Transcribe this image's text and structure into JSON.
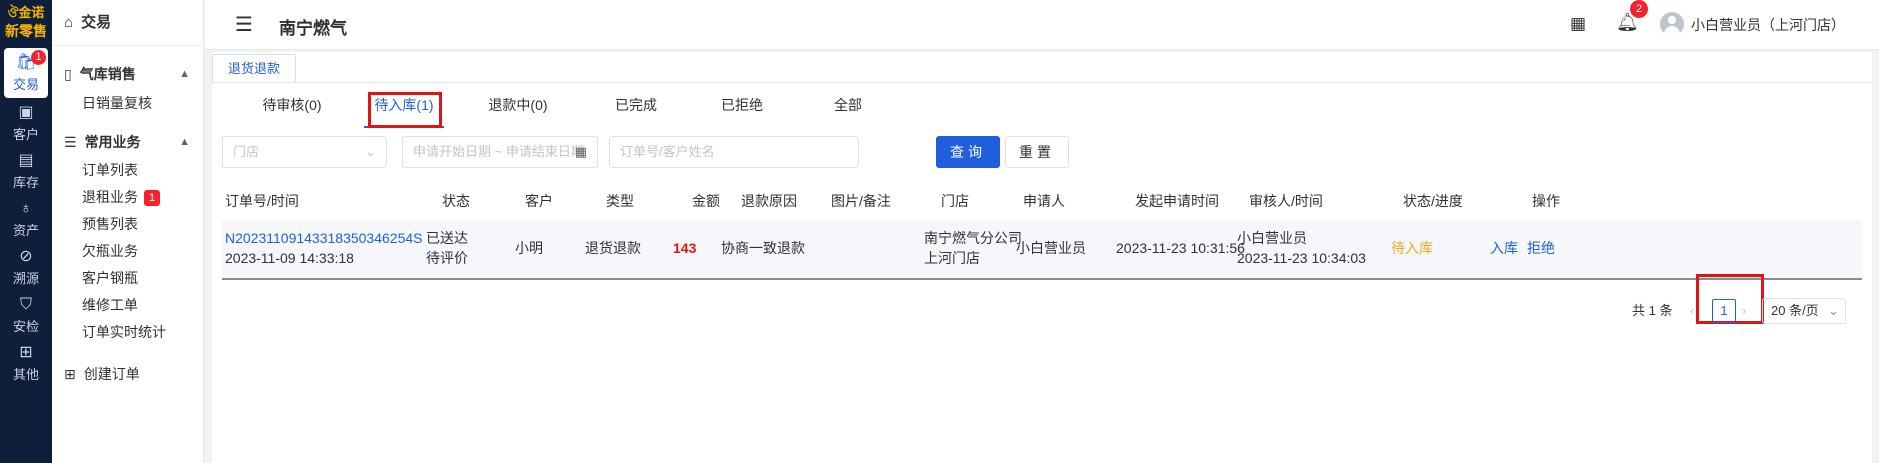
{
  "brand": {
    "line1": "ঔ金诺",
    "line2": "新零售"
  },
  "rail": [
    {
      "icon": "🛍",
      "label": "交易",
      "badge": "1",
      "active": true
    },
    {
      "icon": "▣",
      "label": "客户"
    },
    {
      "icon": "▤",
      "label": "库存"
    },
    {
      "icon": "♁",
      "label": "资产"
    },
    {
      "icon": "⊘",
      "label": "溯源"
    },
    {
      "icon": "⛉",
      "label": "安检"
    },
    {
      "icon": "⊞",
      "label": "其他"
    }
  ],
  "menu": {
    "top": "交易",
    "group1": "气库销售",
    "group1_items": [
      "日销量复核"
    ],
    "group2": "常用业务",
    "group2_items": [
      "订单列表",
      "退租业务",
      "预售列表",
      "欠瓶业务",
      "客户钢瓶",
      "维修工单",
      "订单实时统计"
    ],
    "group2_badge": "1",
    "create": "创建订单"
  },
  "header": {
    "title": "南宁燃气",
    "bell_badge": "2",
    "user": "小白营业员（上河门店）"
  },
  "crumb_tab": "退货退款",
  "tabs": [
    "待审核(0)",
    "待入库(1)",
    "退款中(0)",
    "已完成",
    "已拒绝",
    "全部"
  ],
  "filters": {
    "store_placeholder": "门店",
    "date_start": "申请开始日期",
    "date_sep": "~",
    "date_end": "申请结束日期",
    "order_placeholder": "订单号/客户姓名",
    "query": "查询",
    "reset": "重置"
  },
  "table": {
    "headers": [
      "订单号/时间",
      "状态",
      "客户",
      "类型",
      "金额",
      "退款原因",
      "图片/备注",
      "门店",
      "申请人",
      "发起申请时间",
      "审核人/时间",
      "状态/进度",
      "操作"
    ],
    "rows": [
      {
        "order_no": "N20231109143318350346254S",
        "order_time": "2023-11-09 14:33:18",
        "status1": "已送达",
        "status2": "待评价",
        "customer": "小明",
        "type": "退货退款",
        "amount": "143",
        "reason": "协商一致退款",
        "store1": "南宁燃气分公司",
        "store2": "上河门店",
        "applicant": "小白营业员",
        "apply_time": "2023-11-23 10:31:56",
        "reviewer": "小白营业员",
        "review_time": "2023-11-23 10:34:03",
        "progress": "待入库",
        "action_in": "入库",
        "action_reject": "拒绝"
      }
    ]
  },
  "pager": {
    "total": "共 1 条",
    "page": "1",
    "size": "20 条/页"
  }
}
